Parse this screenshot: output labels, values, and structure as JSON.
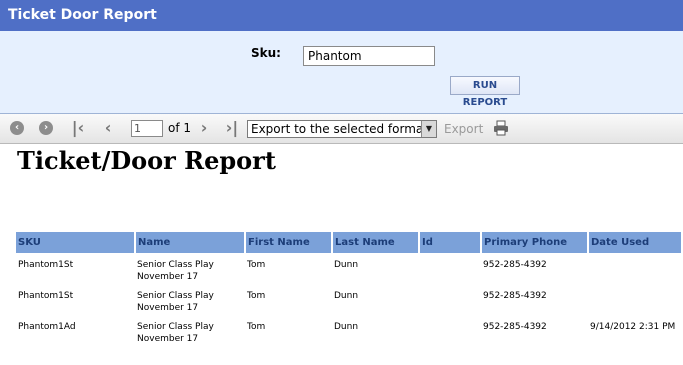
{
  "header": {
    "title": "Ticket Door Report"
  },
  "params": {
    "sku_label": "Sku:",
    "sku_value": "Phantom",
    "run_label": "RUN REPORT"
  },
  "toolbar": {
    "icons": [
      "back-icon",
      "forward-icon",
      "first-page-icon",
      "previous-page-icon",
      "next-page-icon",
      "last-page-icon",
      "print-icon"
    ],
    "page_value": "1",
    "of_label": "of 1",
    "export_format": "Export to the selected format",
    "export_label": "Export"
  },
  "report": {
    "title": "Ticket/Door Report",
    "columns": [
      "SKU",
      "Name",
      "First Name",
      "Last Name",
      "Id",
      "Primary Phone",
      "Date Used"
    ],
    "rows": [
      [
        "Phantom1St",
        "Senior Class Play November 17",
        "Tom",
        "Dunn",
        "",
        "952-285-4392",
        ""
      ],
      [
        "Phantom1St",
        "Senior Class Play November 17",
        "Tom",
        "Dunn",
        "",
        "952-285-4392",
        ""
      ],
      [
        "Phantom1Ad",
        "Senior Class Play November 17",
        "Tom",
        "Dunn",
        "",
        "952-285-4392",
        "9/14/2012 2:31 PM"
      ]
    ]
  }
}
